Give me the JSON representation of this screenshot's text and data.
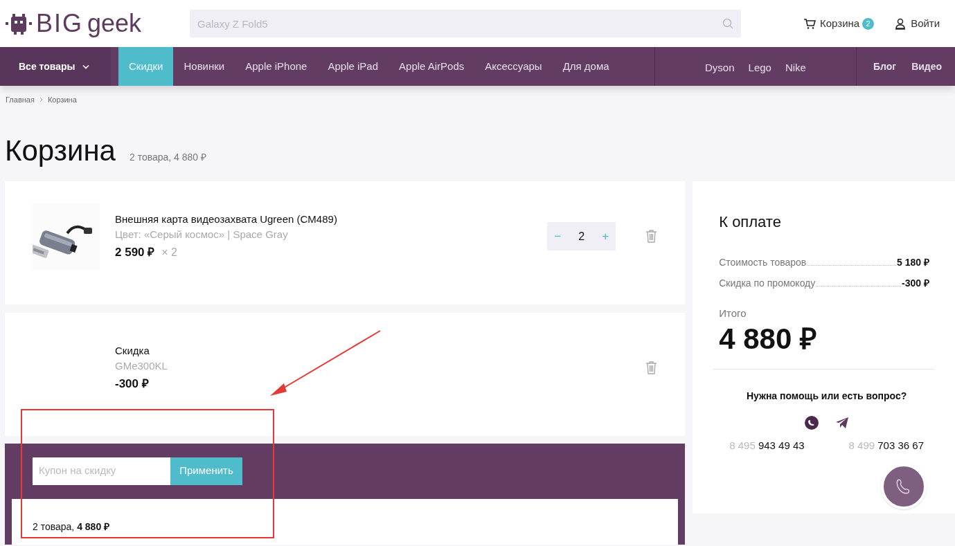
{
  "header": {
    "logo_text": "BIG",
    "logo_text_2": "geek",
    "search": {
      "placeholder": "Galaxy Z Fold5"
    },
    "cart": {
      "label": "Корзина",
      "count": "2"
    },
    "login": "Войти"
  },
  "nav": {
    "all": "Все товары",
    "categories": [
      {
        "label": "Скидки",
        "selected": true
      },
      {
        "label": "Новинки",
        "selected": false
      },
      {
        "label": "Apple iPhone",
        "selected": false
      },
      {
        "label": "Apple iPad",
        "selected": false
      },
      {
        "label": "Apple AirPods",
        "selected": false
      },
      {
        "label": "Аксессуары",
        "selected": false
      },
      {
        "label": "Для дома",
        "selected": false
      }
    ],
    "brands": [
      "Dyson",
      "Lego",
      "Nike"
    ],
    "extra": [
      "Блог",
      "Видео"
    ]
  },
  "breadcrumbs": [
    "Главная",
    "Корзина"
  ],
  "page": {
    "title": "Корзина",
    "summary": "2 товара, 4 880 ₽"
  },
  "cart_items": [
    {
      "kind": "product",
      "name": "Внешняя карта видеозахвата Ugreen (CM489)",
      "variant": "Цвет: «Серый космос» | Space Gray",
      "price": "2 590 ₽",
      "multiplier": "× 2",
      "quantity": {
        "minus": "−",
        "value": "2",
        "plus": "+"
      }
    },
    {
      "kind": "discount",
      "name": "Скидка",
      "variant": "GMe300KL",
      "price": "-300 ₽"
    }
  ],
  "coupon": {
    "placeholder": "Купон на скидку",
    "button": "Применить",
    "totals": "2 товара, **4 880 ₽**"
  },
  "checkout": {
    "title": "К оплате",
    "lines": [
      {
        "label": "Стоимость товаров",
        "value": "5 180 ₽"
      },
      {
        "label": "Скидка по промокоду",
        "value": "-300 ₽"
      }
    ],
    "total_label": "Итого",
    "total": "4 880 ₽",
    "help": "Нужна помощь или есть вопрос?",
    "phones": [
      {
        "prefix": "8 495",
        "number": "943 49 43"
      },
      {
        "prefix": "8 499",
        "number": "703 36 67"
      }
    ]
  }
}
